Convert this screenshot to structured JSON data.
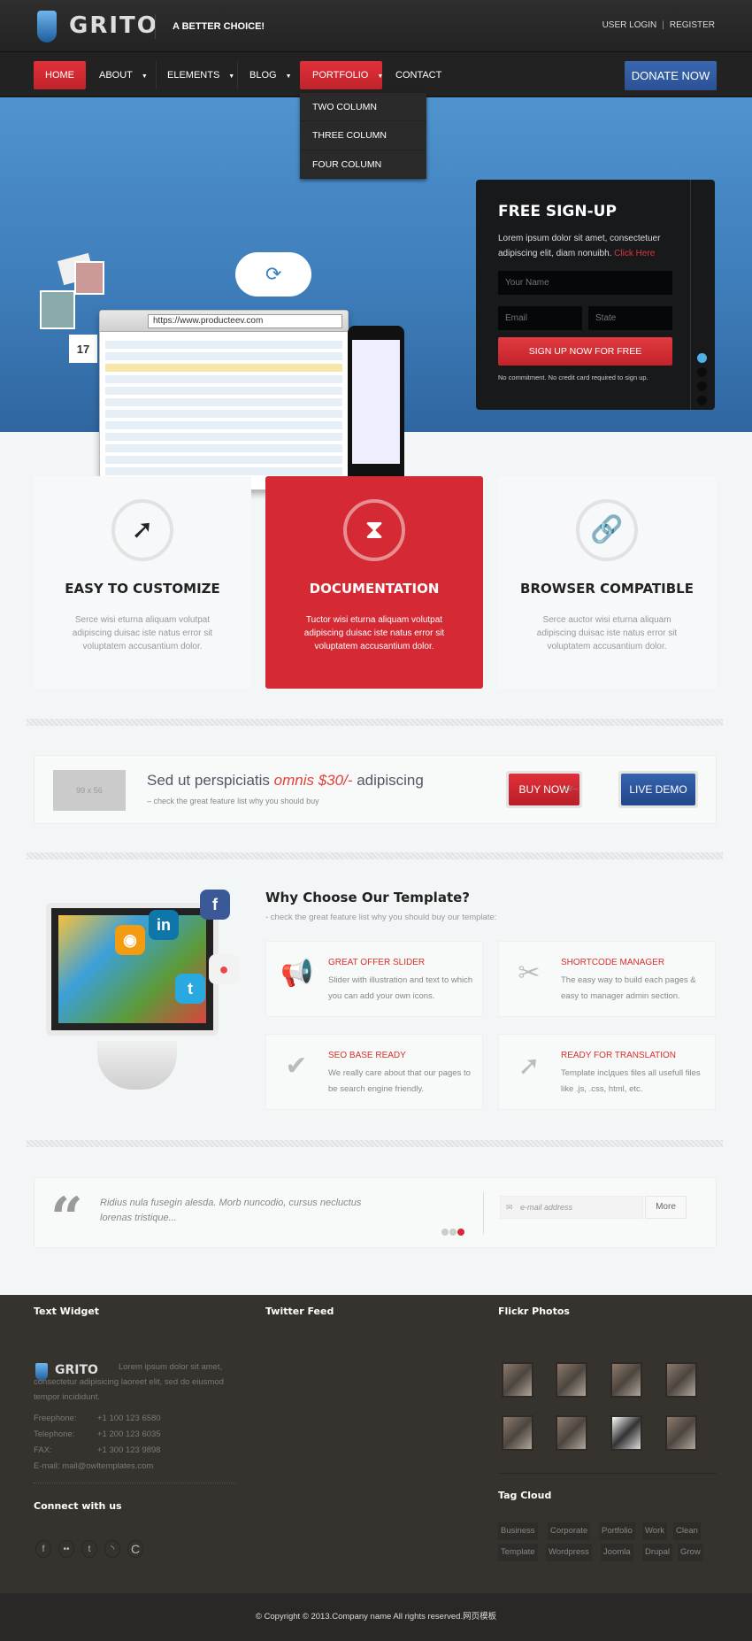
{
  "header": {
    "logo": "GRITO",
    "tagline": "A BETTER CHOICE!",
    "user_login": "USER LOGIN",
    "register": "REGISTER"
  },
  "nav": {
    "items": [
      {
        "label": "HOME",
        "active": true
      },
      {
        "label": "ABOUT",
        "has_submenu": true
      },
      {
        "label": "ELEMENTS",
        "has_submenu": true
      },
      {
        "label": "BLOG",
        "has_submenu": true
      },
      {
        "label": "PORTFOLIO",
        "has_submenu": true,
        "open": true
      },
      {
        "label": "CONTACT"
      }
    ],
    "donate": "DONATE NOW",
    "dropdown": [
      "TWO COLUMN",
      "THREE COLUMN",
      "FOUR COLUMN"
    ]
  },
  "hero": {
    "browser_url": "https://www.producteev.com",
    "calendar_day": "17"
  },
  "signup": {
    "title": "FREE SIGN-UP",
    "text": "Lorem ipsum dolor sit amet, consectetuer adipiscing elit, diam nonuibh.",
    "link": "Click Here",
    "name_placeholder": "Your Name",
    "email_placeholder": "Email",
    "state_placeholder": "State",
    "button": "SIGN UP NOW FOR FREE",
    "note": "No commitment. No credit card required to sign up.",
    "active_slide": 1,
    "slides": 4
  },
  "features": [
    {
      "icon": "trending-up-icon",
      "title": "EASY TO CUSTOMIZE",
      "text": "Serce wisi eturna aliquam volutpat adipiscing duisac iste natus error sit voluptatem accusantium dolor."
    },
    {
      "icon": "hourglass-icon",
      "title": "DOCUMENTATION",
      "text": "Tuctor wisi eturna aliquam volutpat adipiscing duisac iste natus error sit voluptatem accusantium dolor."
    },
    {
      "icon": "link-icon",
      "title": "BROWSER COMPATIBLE",
      "text": "Serce auctor wisi eturna aliquam adipiscing duisac iste natus error sit voluptatem accusantium dolor."
    }
  ],
  "cta": {
    "placeholder": "99 x 56",
    "title_pre": "Sed ut perspiciatis ",
    "title_em": "omnis $30/-",
    "title_post": " adipiscing",
    "subtitle": "– check the great feature list why you should buy",
    "buy": "BUY NOW",
    "or": "–or–",
    "demo": "LIVE DEMO"
  },
  "why": {
    "title": "Why Choose Our Template?",
    "subtitle": "- check the great feature list why you should buy our template:",
    "cards": [
      {
        "icon": "megaphone-icon",
        "title": "GREAT OFFER SLIDER",
        "text": "Slider with illustration and text to which you can add your own icons."
      },
      {
        "icon": "scissors-icon",
        "title": "SHORTCODE MANAGER",
        "text": "The easy way to build each pages & easy to manager admin section."
      },
      {
        "icon": "chat-check-icon",
        "title": "SEO BASE READY",
        "text": "We really care about that our pages to be search engine friendly."
      },
      {
        "icon": "trending-up-icon",
        "title": "READY FOR TRANSLATION",
        "text": "Template inclдues files all usefull files like .js, .css, html, etc."
      }
    ]
  },
  "testimonial": {
    "text": "Ridius nula fusegin alesda. Morb nuncodio, cursus necluctus lorenas tristique...",
    "email_placeholder": "e-mail address",
    "more": "More",
    "active_dot": 3
  },
  "footer": {
    "text_widget": "Text Widget",
    "logo": "GRITO",
    "about": "Lorem ipsum dolor sit amet, consectetur adipisicing laoreet elit, sed do eiusmod tempor incididunt.",
    "contacts": [
      {
        "label": "Freephone:",
        "value": "+1 100 123 6580"
      },
      {
        "label": "Telephone:",
        "value": "+1 200 123 6035"
      },
      {
        "label": "FAX:",
        "value": "+1 300 123 9898"
      }
    ],
    "email_label": "E-mail:",
    "email": "mail@owltemplates.com",
    "connect": "Connect with us",
    "twitter": "Twitter Feed",
    "flickr": "Flickr Photos",
    "tag_cloud": "Tag Cloud",
    "tags": [
      "Business",
      "Corporate",
      "Portfolio",
      "Work",
      "Clean",
      "Template",
      "Wordpress",
      "Joomla",
      "Drupal",
      "Grow"
    ],
    "copyright": "© Copyright © 2013.Company name All rights reserved.网页模板"
  },
  "colors": {
    "red": "#d52a33",
    "blue": "#2b5195",
    "hero": "#3f82bd",
    "footer": "#36322e"
  }
}
